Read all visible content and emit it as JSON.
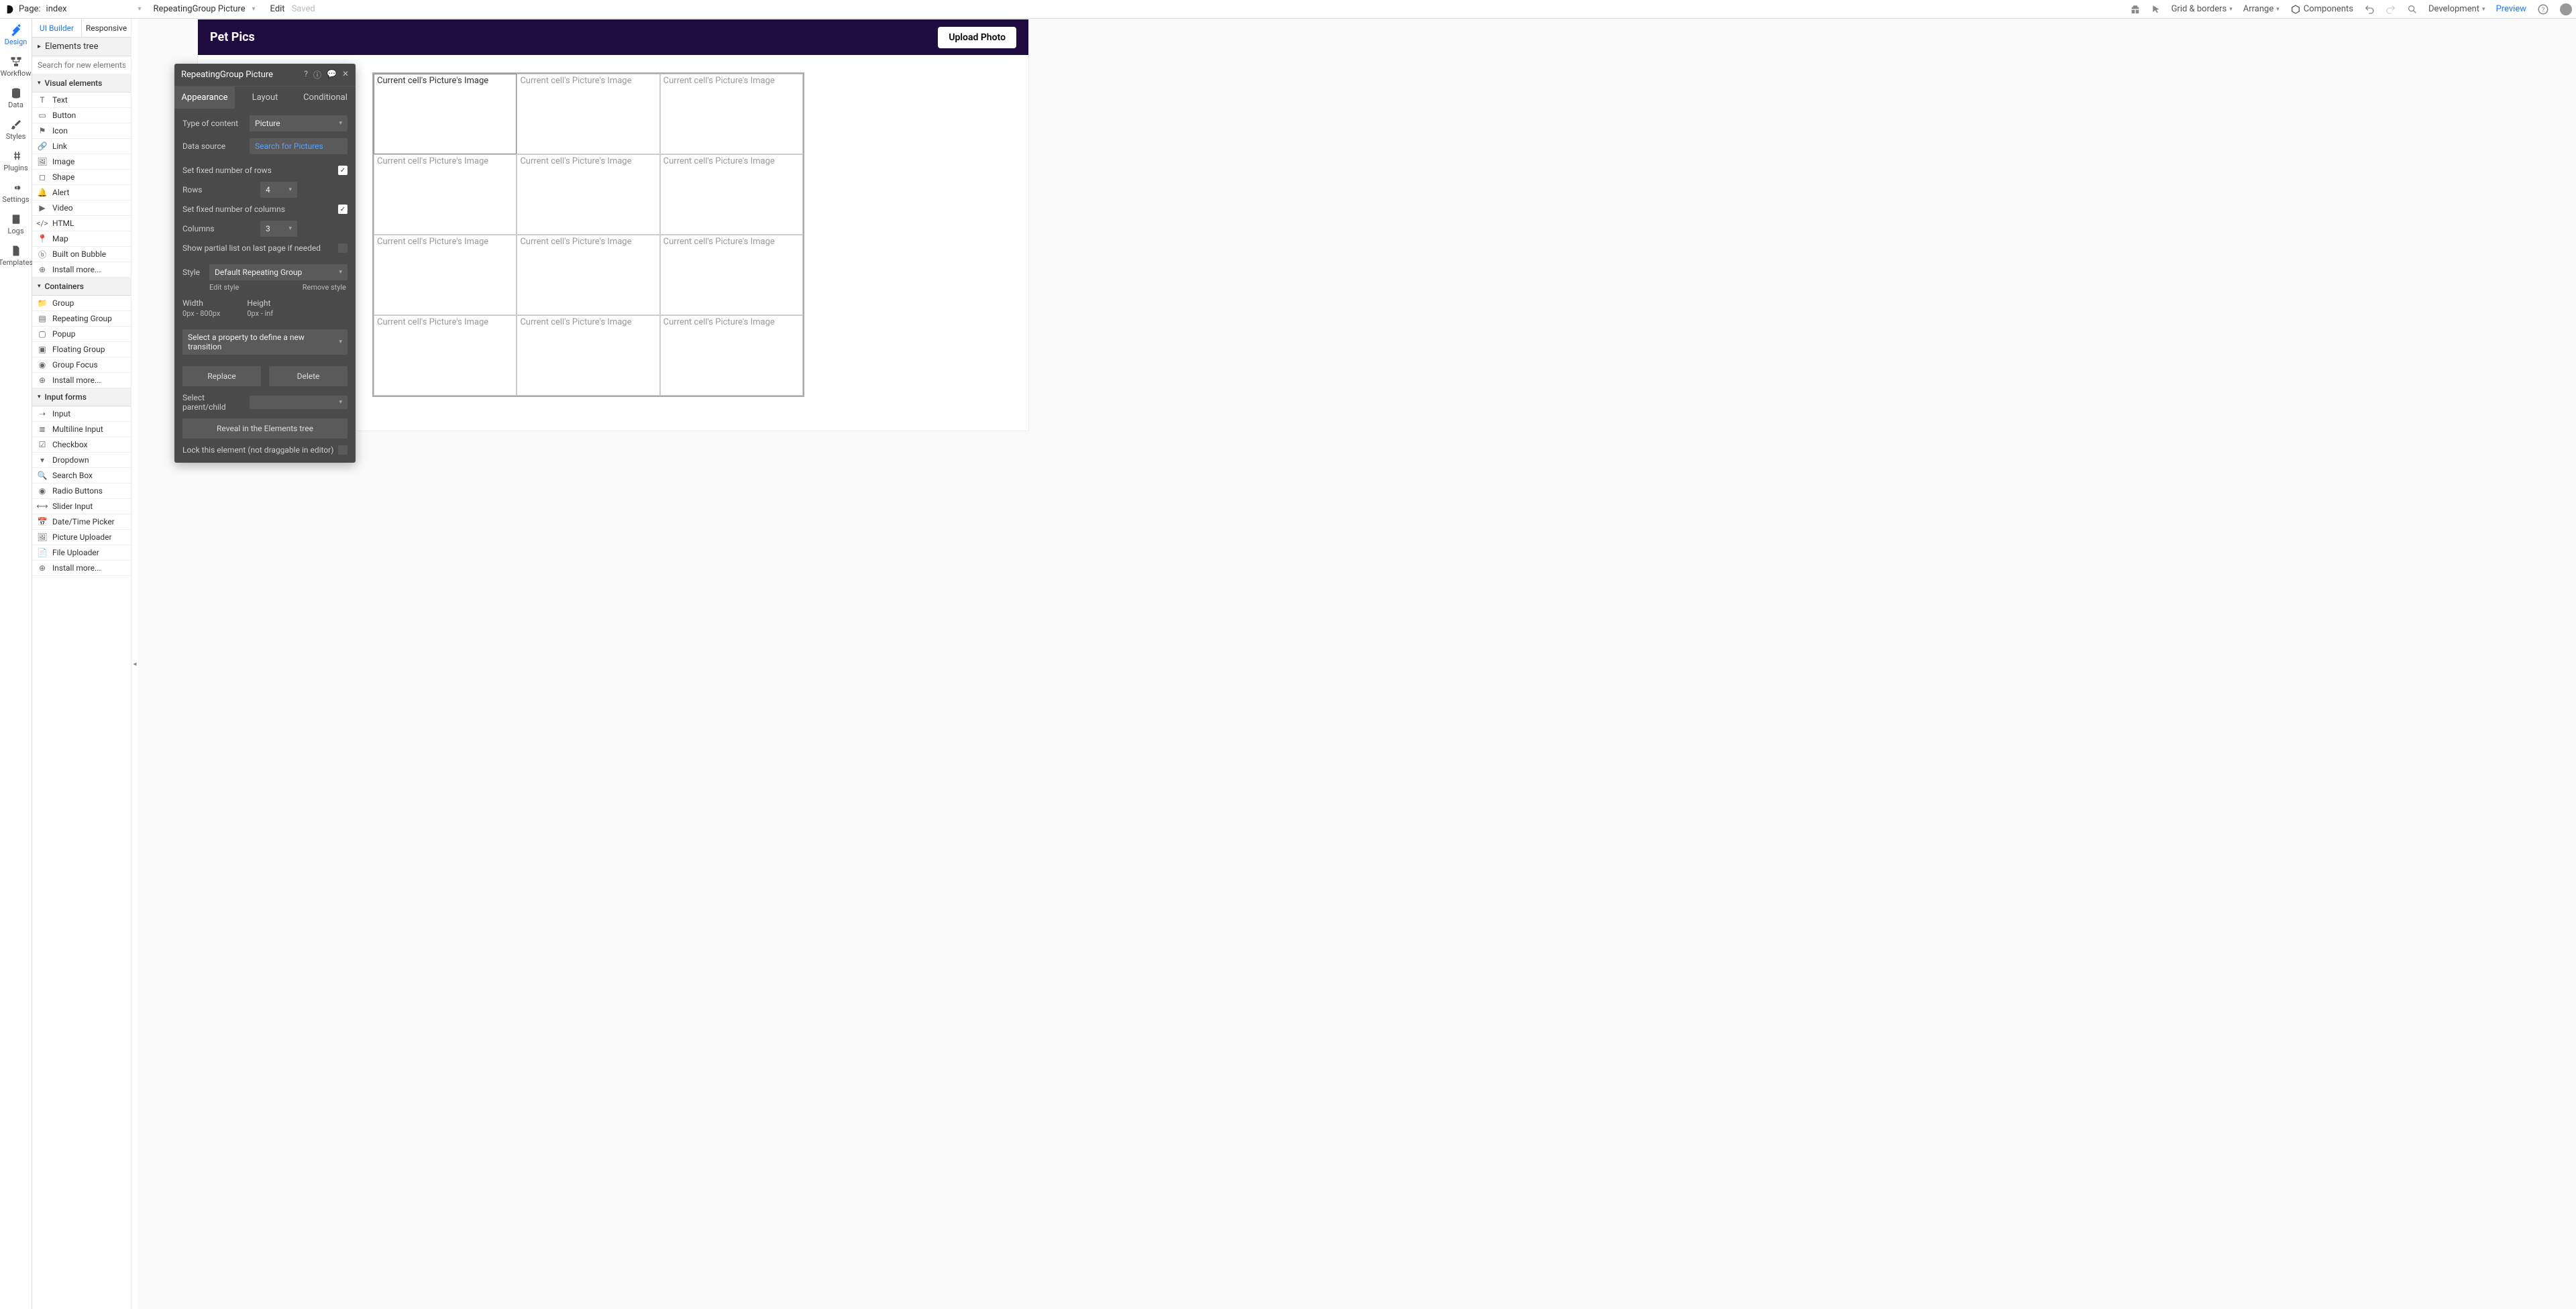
{
  "topbar": {
    "page_label": "Page:",
    "page_name": "index",
    "element_name": "RepeatingGroup Picture",
    "edit": "Edit",
    "saved": "Saved",
    "grid_borders": "Grid & borders",
    "arrange": "Arrange",
    "components": "Components",
    "development": "Development",
    "preview": "Preview"
  },
  "rail": [
    {
      "label": "Design",
      "icon": "tools"
    },
    {
      "label": "Workflow",
      "icon": "flow"
    },
    {
      "label": "Data",
      "icon": "db"
    },
    {
      "label": "Styles",
      "icon": "brush"
    },
    {
      "label": "Plugins",
      "icon": "plug"
    },
    {
      "label": "Settings",
      "icon": "gear"
    },
    {
      "label": "Logs",
      "icon": "logs"
    },
    {
      "label": "Templates",
      "icon": "doc"
    }
  ],
  "panel_tabs": {
    "ui": "UI Builder",
    "responsive": "Responsive"
  },
  "elements_tree": "Elements tree",
  "search_placeholder": "Search for new elements...",
  "sections": {
    "visual": "Visual elements",
    "containers": "Containers",
    "input_forms": "Input forms"
  },
  "visual_items": [
    "Text",
    "Button",
    "Icon",
    "Link",
    "Image",
    "Shape",
    "Alert",
    "Video",
    "HTML",
    "Map",
    "Built on Bubble",
    "Install more..."
  ],
  "container_items": [
    "Group",
    "Repeating Group",
    "Popup",
    "Floating Group",
    "Group Focus",
    "Install more..."
  ],
  "input_items": [
    "Input",
    "Multiline Input",
    "Checkbox",
    "Dropdown",
    "Search Box",
    "Radio Buttons",
    "Slider Input",
    "Date/Time Picker",
    "Picture Uploader",
    "File Uploader",
    "Install more..."
  ],
  "canvas": {
    "title": "Pet Pics",
    "upload": "Upload Photo",
    "cell_placeholder": "Current cell's Picture's Image"
  },
  "prop": {
    "title": "RepeatingGroup Picture",
    "tabs": {
      "appearance": "Appearance",
      "layout": "Layout",
      "conditional": "Conditional"
    },
    "type_of_content": "Type of content",
    "type_value": "Picture",
    "data_source": "Data source",
    "data_source_value": "Search for Pictures",
    "fixed_rows": "Set fixed number of rows",
    "rows": "Rows",
    "rows_val": "4",
    "fixed_cols": "Set fixed number of columns",
    "cols": "Columns",
    "cols_val": "3",
    "partial": "Show partial list on last page if needed",
    "style": "Style",
    "style_val": "Default Repeating Group",
    "edit_style": "Edit style",
    "remove_style": "Remove style",
    "width": "Width",
    "width_val": "0px - 800px",
    "height": "Height",
    "height_val": "0px - inf",
    "transition": "Select a property to define a new transition",
    "replace": "Replace",
    "delete": "Delete",
    "parent": "Select parent/child",
    "reveal": "Reveal in the Elements tree",
    "lock": "Lock this element (not draggable in editor)"
  }
}
